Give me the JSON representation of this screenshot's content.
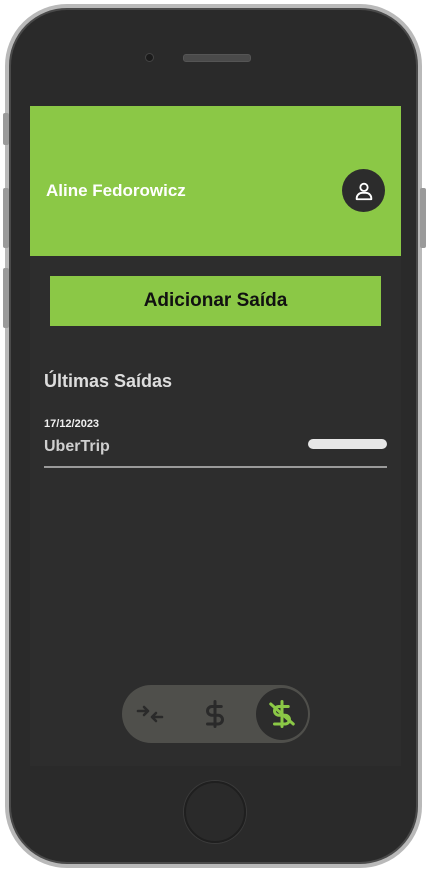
{
  "header": {
    "user_name": "Aline Fedorowicz",
    "avatar_icon": "user-icon",
    "background_color": "#8bc846"
  },
  "actions": {
    "add_label": "Adicionar Saída"
  },
  "recent": {
    "title": "Últimas Saídas",
    "items": [
      {
        "date": "17/12/2023",
        "name": "UberTrip"
      }
    ]
  },
  "nav": {
    "items": [
      {
        "icon": "transfer-arrows-icon",
        "active": false
      },
      {
        "icon": "dollar-icon",
        "active": false
      },
      {
        "icon": "dollar-off-icon",
        "active": true
      }
    ],
    "accent_color": "#8bc846"
  }
}
